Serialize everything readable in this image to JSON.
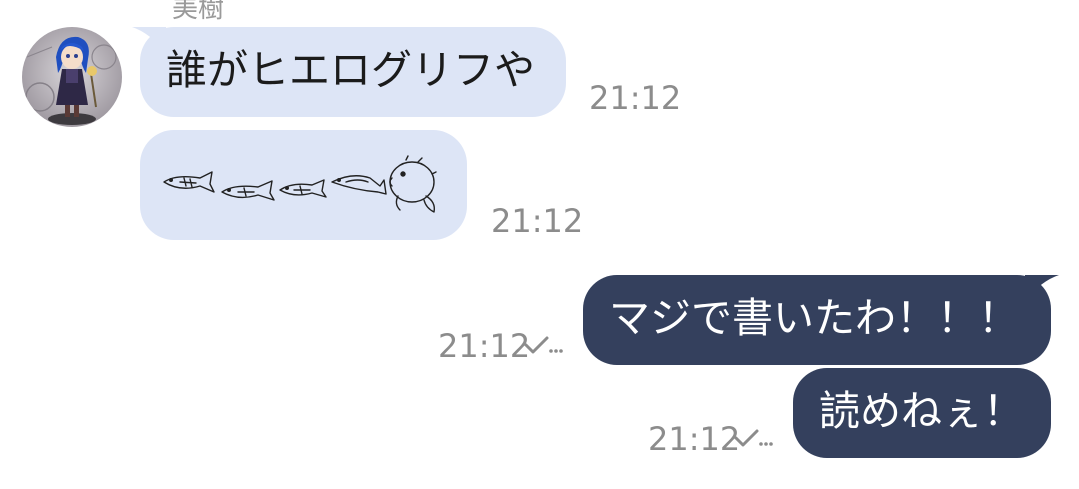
{
  "chat": {
    "sender_name": "美樹",
    "messages": [
      {
        "direction": "incoming",
        "text": "誰がヒエログリフや",
        "time": "21:12"
      },
      {
        "direction": "incoming",
        "type": "image",
        "image_content": "fish-doodle-sticker",
        "time": "21:12"
      },
      {
        "direction": "outgoing",
        "text": "マジで書いたわ！！！",
        "time": "21:12",
        "status_icon": "read-check-icon"
      },
      {
        "direction": "outgoing",
        "text": "読めねぇ！",
        "time": "21:12",
        "status_icon": "read-check-icon"
      }
    ]
  },
  "colors": {
    "incoming_bubble": "#dde5f6",
    "outgoing_bubble": "#34405d",
    "outgoing_text": "#ffffff",
    "timestamp": "#8c8c8c",
    "background": "#ffffff"
  }
}
